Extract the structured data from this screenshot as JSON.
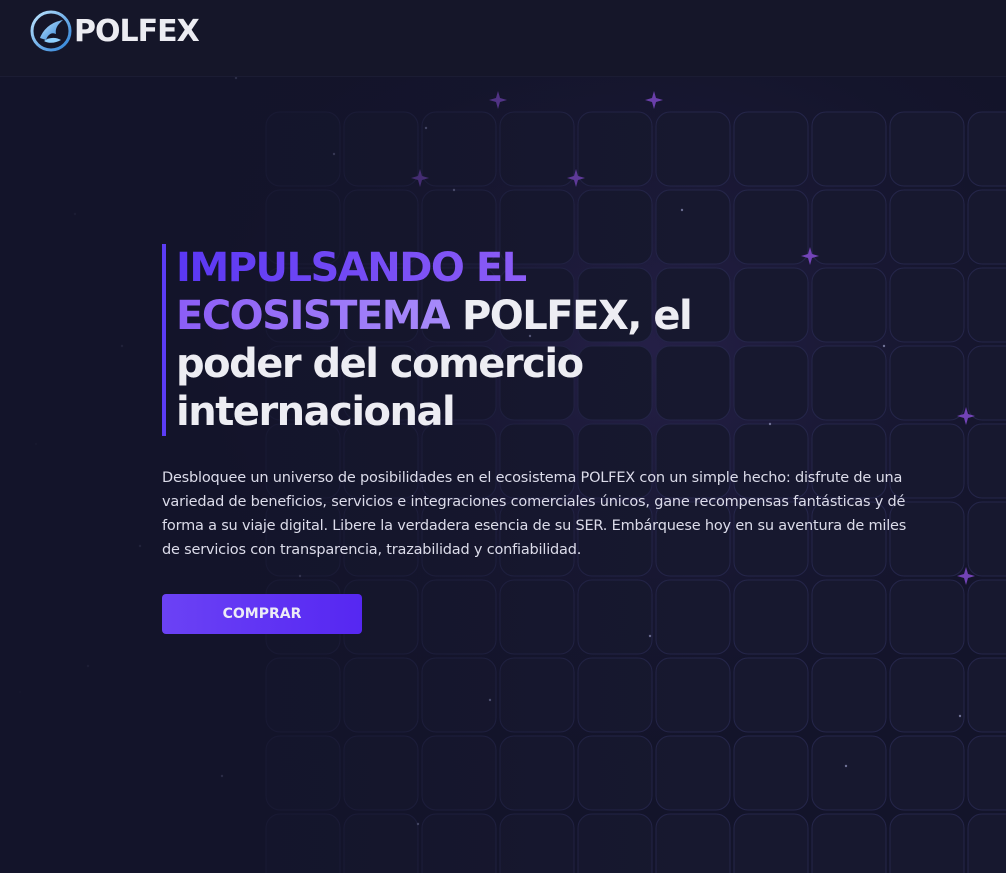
{
  "brand": {
    "name": "POLFEX",
    "logo_icon": "phoenix-logo-icon"
  },
  "hero": {
    "headline_accent": "IMPULSANDO EL ECOSISTEMA",
    "headline_rest": " POLFEX, el poder del comercio internacional",
    "description": "Desbloquee un universo de posibilidades en el ecosistema POLFEX con un simple hecho: disfrute de una variedad de beneficios, servicios e integraciones comerciales únicos, gane recompensas fantásticas y dé forma a su viaje digital. Libere la verdadera esencia de su SER. Embárquese hoy en su aventura de miles de servicios con transparencia, trazabilidad y confiabilidad.",
    "cta_label": "COMPRAR"
  },
  "colors": {
    "background": "#13142a",
    "accent_start": "#5a37f4",
    "accent_end": "#a78bfa",
    "button": "#5b30f3"
  }
}
